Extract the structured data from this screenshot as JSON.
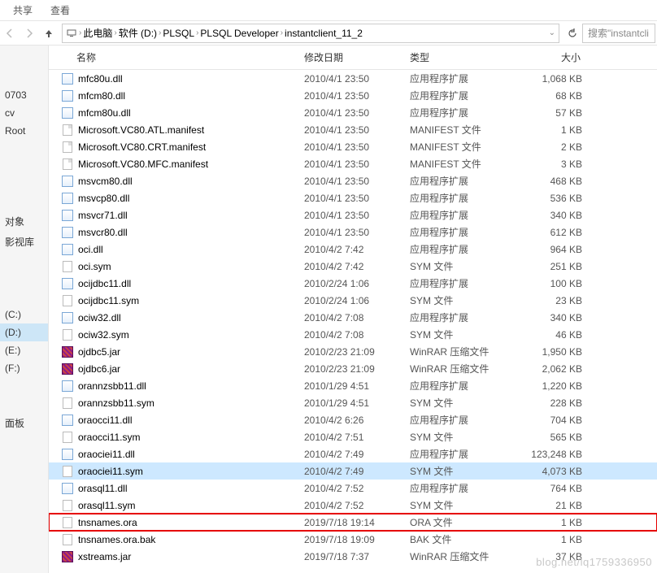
{
  "tabs": {
    "share": "共享",
    "view": "查看"
  },
  "breadcrumb": {
    "items": [
      "此电脑",
      "软件 (D:)",
      "PLSQL",
      "PLSQL Developer",
      "instantclient_11_2"
    ]
  },
  "search": {
    "placeholder": "搜索\"instantcli"
  },
  "sidebar": {
    "pin_items": [
      "",
      "",
      "0703",
      "cv",
      "Root",
      "",
      "",
      "",
      "",
      "对象",
      "影视库",
      "",
      "",
      "",
      "(C:)",
      "(D:)",
      "(E:)",
      "(F:)",
      "",
      "",
      "面板",
      ""
    ]
  },
  "columns": {
    "name": "名称",
    "date": "修改日期",
    "type": "类型",
    "size": "大小"
  },
  "files": [
    {
      "icon": "dll",
      "name": "mfc80u.dll",
      "date": "2010/4/1 23:50",
      "type": "应用程序扩展",
      "size": "1,068 KB"
    },
    {
      "icon": "dll",
      "name": "mfcm80.dll",
      "date": "2010/4/1 23:50",
      "type": "应用程序扩展",
      "size": "68 KB"
    },
    {
      "icon": "dll",
      "name": "mfcm80u.dll",
      "date": "2010/4/1 23:50",
      "type": "应用程序扩展",
      "size": "57 KB"
    },
    {
      "icon": "man",
      "name": "Microsoft.VC80.ATL.manifest",
      "date": "2010/4/1 23:50",
      "type": "MANIFEST 文件",
      "size": "1 KB"
    },
    {
      "icon": "man",
      "name": "Microsoft.VC80.CRT.manifest",
      "date": "2010/4/1 23:50",
      "type": "MANIFEST 文件",
      "size": "2 KB"
    },
    {
      "icon": "man",
      "name": "Microsoft.VC80.MFC.manifest",
      "date": "2010/4/1 23:50",
      "type": "MANIFEST 文件",
      "size": "3 KB"
    },
    {
      "icon": "dll",
      "name": "msvcm80.dll",
      "date": "2010/4/1 23:50",
      "type": "应用程序扩展",
      "size": "468 KB"
    },
    {
      "icon": "dll",
      "name": "msvcp80.dll",
      "date": "2010/4/1 23:50",
      "type": "应用程序扩展",
      "size": "536 KB"
    },
    {
      "icon": "dll",
      "name": "msvcr71.dll",
      "date": "2010/4/1 23:50",
      "type": "应用程序扩展",
      "size": "340 KB"
    },
    {
      "icon": "dll",
      "name": "msvcr80.dll",
      "date": "2010/4/1 23:50",
      "type": "应用程序扩展",
      "size": "612 KB"
    },
    {
      "icon": "dll",
      "name": "oci.dll",
      "date": "2010/4/2 7:42",
      "type": "应用程序扩展",
      "size": "964 KB"
    },
    {
      "icon": "txt",
      "name": "oci.sym",
      "date": "2010/4/2 7:42",
      "type": "SYM 文件",
      "size": "251 KB"
    },
    {
      "icon": "dll",
      "name": "ocijdbc11.dll",
      "date": "2010/2/24 1:06",
      "type": "应用程序扩展",
      "size": "100 KB"
    },
    {
      "icon": "txt",
      "name": "ocijdbc11.sym",
      "date": "2010/2/24 1:06",
      "type": "SYM 文件",
      "size": "23 KB"
    },
    {
      "icon": "dll",
      "name": "ociw32.dll",
      "date": "2010/4/2 7:08",
      "type": "应用程序扩展",
      "size": "340 KB"
    },
    {
      "icon": "txt",
      "name": "ociw32.sym",
      "date": "2010/4/2 7:08",
      "type": "SYM 文件",
      "size": "46 KB"
    },
    {
      "icon": "rar",
      "name": "ojdbc5.jar",
      "date": "2010/2/23 21:09",
      "type": "WinRAR 压缩文件",
      "size": "1,950 KB"
    },
    {
      "icon": "rar",
      "name": "ojdbc6.jar",
      "date": "2010/2/23 21:09",
      "type": "WinRAR 压缩文件",
      "size": "2,062 KB"
    },
    {
      "icon": "dll",
      "name": "orannzsbb11.dll",
      "date": "2010/1/29 4:51",
      "type": "应用程序扩展",
      "size": "1,220 KB"
    },
    {
      "icon": "txt",
      "name": "orannzsbb11.sym",
      "date": "2010/1/29 4:51",
      "type": "SYM 文件",
      "size": "228 KB"
    },
    {
      "icon": "dll",
      "name": "oraocci11.dll",
      "date": "2010/4/2 6:26",
      "type": "应用程序扩展",
      "size": "704 KB"
    },
    {
      "icon": "txt",
      "name": "oraocci11.sym",
      "date": "2010/4/2 7:51",
      "type": "SYM 文件",
      "size": "565 KB"
    },
    {
      "icon": "dll",
      "name": "oraociei11.dll",
      "date": "2010/4/2 7:49",
      "type": "应用程序扩展",
      "size": "123,248 KB"
    },
    {
      "icon": "txt",
      "name": "oraociei11.sym",
      "date": "2010/4/2 7:49",
      "type": "SYM 文件",
      "size": "4,073 KB",
      "selected": true
    },
    {
      "icon": "dll",
      "name": "orasql11.dll",
      "date": "2010/4/2 7:52",
      "type": "应用程序扩展",
      "size": "764 KB"
    },
    {
      "icon": "txt",
      "name": "orasql11.sym",
      "date": "2010/4/2 7:52",
      "type": "SYM 文件",
      "size": "21 KB"
    },
    {
      "icon": "txt",
      "name": "tnsnames.ora",
      "date": "2019/7/18 19:14",
      "type": "ORA 文件",
      "size": "1 KB",
      "highlight": true
    },
    {
      "icon": "txt",
      "name": "tnsnames.ora.bak",
      "date": "2019/7/18 19:09",
      "type": "BAK 文件",
      "size": "1 KB"
    },
    {
      "icon": "rar",
      "name": "xstreams.jar",
      "date": "2019/7/18 7:37",
      "type": "WinRAR 压缩文件",
      "size": "37 KB"
    }
  ],
  "watermark": "blog.net/lq1759336950"
}
